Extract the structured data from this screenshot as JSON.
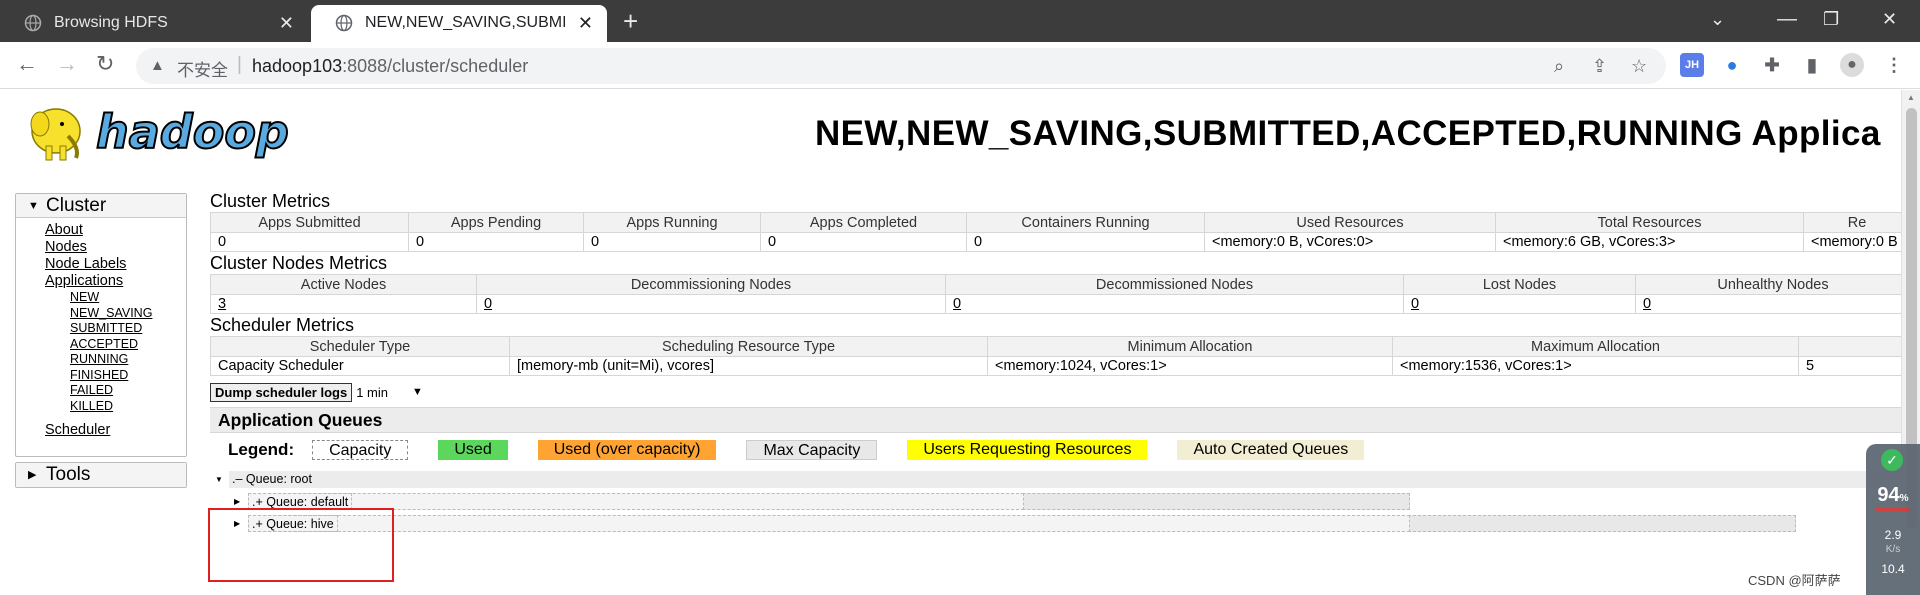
{
  "browser": {
    "tabs": [
      {
        "title": "Browsing HDFS",
        "active": false
      },
      {
        "title": "NEW,NEW_SAVING,SUBMITTE",
        "active": true
      }
    ],
    "address": {
      "security_label": "不安全",
      "host": "hadoop103",
      "path": ":8088/cluster/scheduler"
    },
    "extension_label": "JH"
  },
  "page": {
    "logo_text": "hadoop",
    "heading": "NEW,NEW_SAVING,SUBMITTED,ACCEPTED,RUNNING Applica"
  },
  "sidebar": {
    "cluster_title": "Cluster",
    "links": [
      "About",
      "Nodes",
      "Node Labels",
      "Applications"
    ],
    "app_states": [
      "NEW",
      "NEW_SAVING",
      "SUBMITTED",
      "ACCEPTED",
      "RUNNING",
      "FINISHED",
      "FAILED",
      "KILLED"
    ],
    "scheduler_link": "Scheduler",
    "tools_title": "Tools"
  },
  "cluster_metrics": {
    "title": "Cluster Metrics",
    "headers": [
      "Apps Submitted",
      "Apps Pending",
      "Apps Running",
      "Apps Completed",
      "Containers Running",
      "Used Resources",
      "Total Resources",
      "Re"
    ],
    "values": [
      "0",
      "0",
      "0",
      "0",
      "0",
      "<memory:0 B, vCores:0>",
      "<memory:6 GB, vCores:3>",
      "<memory:0 B"
    ]
  },
  "nodes_metrics": {
    "title": "Cluster Nodes Metrics",
    "headers": [
      "Active Nodes",
      "Decommissioning Nodes",
      "Decommissioned Nodes",
      "Lost Nodes",
      "Unhealthy Nodes"
    ],
    "values": [
      "3",
      "0",
      "0",
      "0",
      "0"
    ]
  },
  "scheduler_metrics": {
    "title": "Scheduler Metrics",
    "headers": [
      "Scheduler Type",
      "Scheduling Resource Type",
      "Minimum Allocation",
      "Maximum Allocation",
      ""
    ],
    "values": [
      "Capacity Scheduler",
      "[memory-mb (unit=Mi), vcores]",
      "<memory:1024, vCores:1>",
      "<memory:1536, vCores:1>",
      "5"
    ]
  },
  "dump": {
    "button": "Dump scheduler logs",
    "interval": "1 min"
  },
  "queues": {
    "title": "Application Queues",
    "legend_label": "Legend:",
    "legend": [
      {
        "label": "Capacity",
        "color": "#ffffff"
      },
      {
        "label": "Used",
        "color": "#5bd75b"
      },
      {
        "label": "Used (over capacity)",
        "color": "#ffa333"
      },
      {
        "label": "Max Capacity",
        "color": "#e8e8e8"
      },
      {
        "label": "Users Requesting Resources",
        "color": "#ffff00"
      },
      {
        "label": "Auto Created Queues",
        "color": "#f2eed3"
      }
    ],
    "tree": [
      {
        "label": "Queue: root",
        "prefix": ".–"
      },
      {
        "label": "Queue: default",
        "prefix": ".+"
      },
      {
        "label": "Queue: hive",
        "prefix": ".+"
      }
    ]
  },
  "widget": {
    "percent": "94",
    "percent_unit": "%",
    "up": "2.9",
    "unit": "K/s",
    "down": "10.4"
  },
  "watermark": "CSDN @阿萨萨"
}
